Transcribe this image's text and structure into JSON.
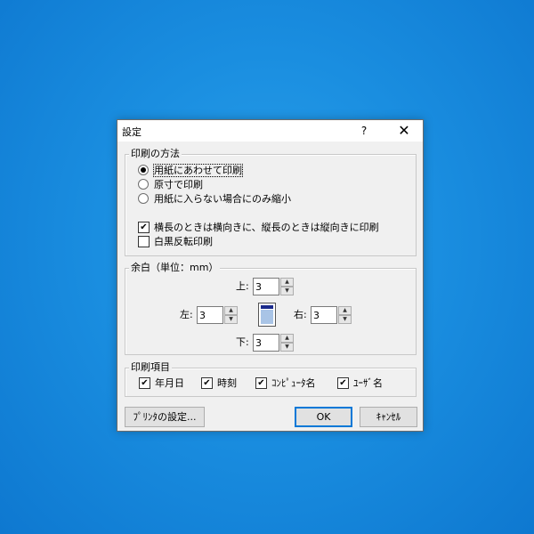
{
  "dialog": {
    "title": "設定",
    "help": "?",
    "close": "✕"
  },
  "print_method": {
    "legend": "印刷の方法",
    "options": [
      {
        "label": "用紙にあわせて印刷",
        "checked": true
      },
      {
        "label": "原寸で印刷",
        "checked": false
      },
      {
        "label": "用紙に入らない場合にのみ縮小",
        "checked": false
      }
    ],
    "landscape_check": {
      "label": "横長のときは横向きに、縦長のときは縦向きに印刷",
      "checked": true
    },
    "mono_check": {
      "label": "白黒反転印刷",
      "checked": false
    }
  },
  "margins": {
    "legend": "余白（単位：mm）",
    "top": {
      "label": "上:",
      "value": "3"
    },
    "left": {
      "label": "左:",
      "value": "3"
    },
    "right": {
      "label": "右:",
      "value": "3"
    },
    "bottom": {
      "label": "下:",
      "value": "3"
    }
  },
  "print_items": {
    "legend": "印刷項目",
    "items": [
      {
        "label": "年月日",
        "checked": true
      },
      {
        "label": "時刻",
        "checked": true
      },
      {
        "label": "ｺﾝﾋﾟｭｰﾀ名",
        "checked": true
      },
      {
        "label": "ﾕｰｻﾞ名",
        "checked": true
      }
    ]
  },
  "buttons": {
    "printer_settings": "ﾌﾟﾘﾝﾀの設定...",
    "ok": "OK",
    "cancel": "ｷｬﾝｾﾙ"
  },
  "glyphs": {
    "check": "✔",
    "up": "▲",
    "down": "▼"
  }
}
